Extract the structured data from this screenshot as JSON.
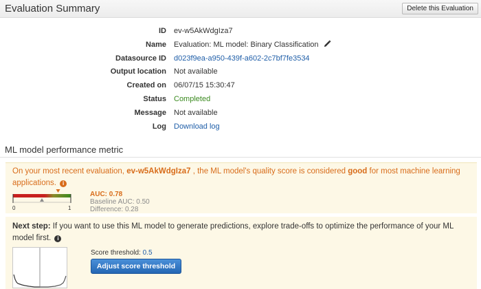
{
  "header": {
    "title": "Evaluation Summary",
    "delete_label": "Delete this Evaluation"
  },
  "details": [
    {
      "label": "ID",
      "value": "ev-w5AkWdgIza7"
    },
    {
      "label": "Name",
      "value": "Evaluation: ML model: Binary Classification"
    },
    {
      "label": "Datasource ID",
      "value": "d023f9ea-a950-439f-a602-2c7bf7fe3534"
    },
    {
      "label": "Output location",
      "value": "Not available"
    },
    {
      "label": "Created on",
      "value": "06/07/15 15:30:47"
    },
    {
      "label": "Status",
      "value": "Completed"
    },
    {
      "label": "Message",
      "value": "Not available"
    },
    {
      "label": "Log",
      "value": "Download log"
    }
  ],
  "performance": {
    "section_title": "ML model performance metric",
    "message_prefix": "On your most recent evaluation, ",
    "eval_id": "ev-w5AkWdgIza7",
    "message_middle": " , the ML model's quality score is considered ",
    "quality": "good",
    "message_suffix": " for most machine learning applications.",
    "gauge_min": "0",
    "gauge_max": "1",
    "auc": 0.78,
    "baseline_auc": 0.5,
    "auc_text": "AUC: 0.78",
    "baseline_text": "Baseline AUC: 0.50",
    "difference_text": "Difference: 0.28"
  },
  "next_step": {
    "label": "Next step:",
    "text": " If you want to use this ML model to generate predictions, explore trade-offs to optimize the performance of your ML model first.",
    "threshold_label": "Score threshold: ",
    "threshold_value": "0.5",
    "threshold": 0.5,
    "adjust_label": "Adjust score threshold"
  },
  "colors": {
    "accent_orange": "#d86c1a",
    "link_blue": "#1f5ea8",
    "status_green": "#3a8a1f",
    "panel_bg": "#fdf8e6",
    "button_blue": "#2f75c5"
  },
  "icons": [
    "pencil-icon",
    "info-icon"
  ]
}
